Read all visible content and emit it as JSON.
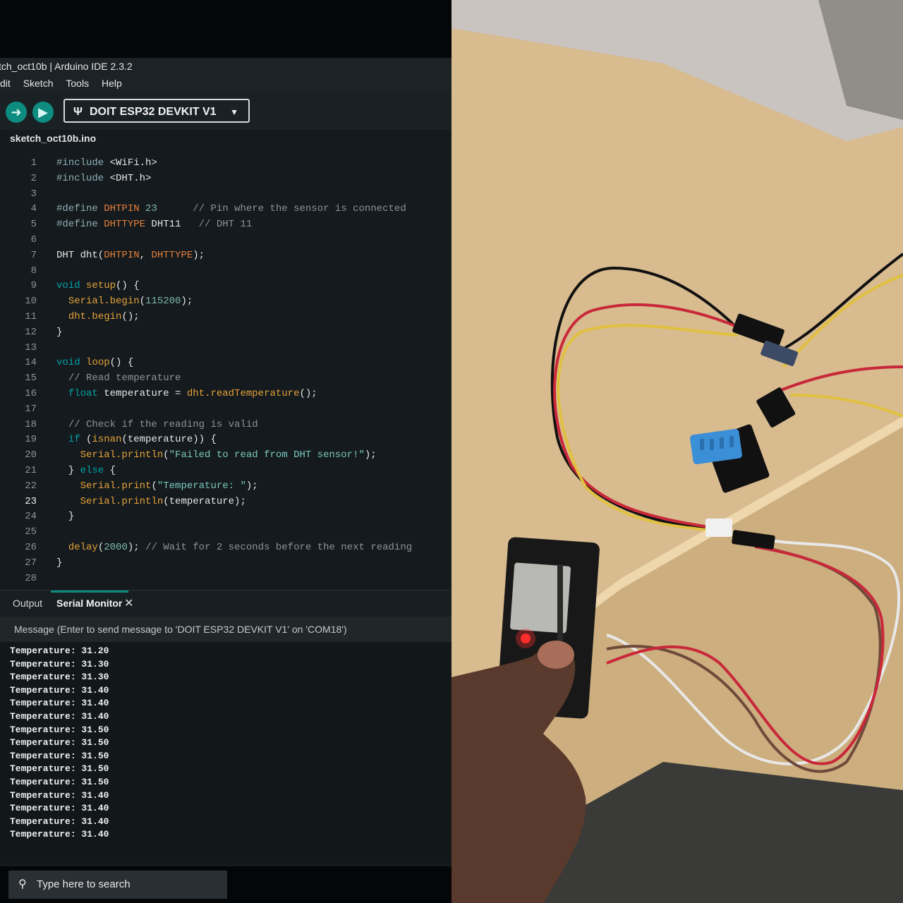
{
  "ide": {
    "window_title": "tch_oct10b | Arduino IDE 2.3.2",
    "menus": [
      "dit",
      "Sketch",
      "Tools",
      "Help"
    ],
    "board": "DOIT ESP32 DEVKIT V1",
    "file_tab": "sketch_oct10b.ino",
    "code": [
      {
        "n": "1",
        "t": "#include <WiFi.h>"
      },
      {
        "n": "2",
        "t": "#include <DHT.h>"
      },
      {
        "n": "3",
        "t": ""
      },
      {
        "n": "4",
        "t": "#define DHTPIN 23      // Pin where the sensor is connected"
      },
      {
        "n": "5",
        "t": "#define DHTTYPE DHT11   // DHT 11"
      },
      {
        "n": "6",
        "t": ""
      },
      {
        "n": "7",
        "t": "DHT dht(DHTPIN, DHTTYPE);"
      },
      {
        "n": "8",
        "t": ""
      },
      {
        "n": "9",
        "t": "void setup() {"
      },
      {
        "n": "10",
        "t": "  Serial.begin(115200);"
      },
      {
        "n": "11",
        "t": "  dht.begin();"
      },
      {
        "n": "12",
        "t": "}"
      },
      {
        "n": "13",
        "t": ""
      },
      {
        "n": "14",
        "t": "void loop() {"
      },
      {
        "n": "15",
        "t": "  // Read temperature"
      },
      {
        "n": "16",
        "t": "  float temperature = dht.readTemperature();"
      },
      {
        "n": "17",
        "t": ""
      },
      {
        "n": "18",
        "t": "  // Check if the reading is valid"
      },
      {
        "n": "19",
        "t": "  if (isnan(temperature)) {"
      },
      {
        "n": "20",
        "t": "    Serial.println(\"Failed to read from DHT sensor!\");"
      },
      {
        "n": "21",
        "t": "  } else {"
      },
      {
        "n": "22",
        "t": "    Serial.print(\"Temperature: \");"
      },
      {
        "n": "23",
        "t": "    Serial.println(temperature);"
      },
      {
        "n": "24",
        "t": "  }"
      },
      {
        "n": "25",
        "t": ""
      },
      {
        "n": "26",
        "t": "  delay(2000); // Wait for 2 seconds before the next reading"
      },
      {
        "n": "27",
        "t": "}"
      },
      {
        "n": "28",
        "t": ""
      }
    ],
    "current_line": "23",
    "panel": {
      "output_tab": "Output",
      "serial_tab": "Serial Monitor",
      "message_placeholder": "Message (Enter to send message to 'DOIT ESP32 DEVKIT V1' on 'COM18')"
    },
    "serial_output": [
      "Temperature: 31.20",
      "Temperature: 31.30",
      "Temperature: 31.30",
      "Temperature: 31.40",
      "Temperature: 31.40",
      "Temperature: 31.40",
      "Temperature: 31.50",
      "Temperature: 31.50",
      "Temperature: 31.50",
      "Temperature: 31.50",
      "Temperature: 31.50",
      "Temperature: 31.40",
      "Temperature: 31.40",
      "Temperature: 31.40",
      "Temperature: 31.40"
    ],
    "taskbar_search": "Type here to search",
    "colors": {
      "accent": "#0e8c80",
      "editor_bg": "#141a1d",
      "keyword": "#00a2a8",
      "macro": "#e8803a",
      "function": "#e6a23a"
    }
  },
  "photo": {
    "colors": {
      "table": "#d9bc8f",
      "sensor": "#3a8fd6",
      "board": "#1a1a1a",
      "led": "#ff2a2a"
    },
    "icons": [
      "esp32-board",
      "dht11-sensor",
      "jumper-wires",
      "hand"
    ]
  }
}
